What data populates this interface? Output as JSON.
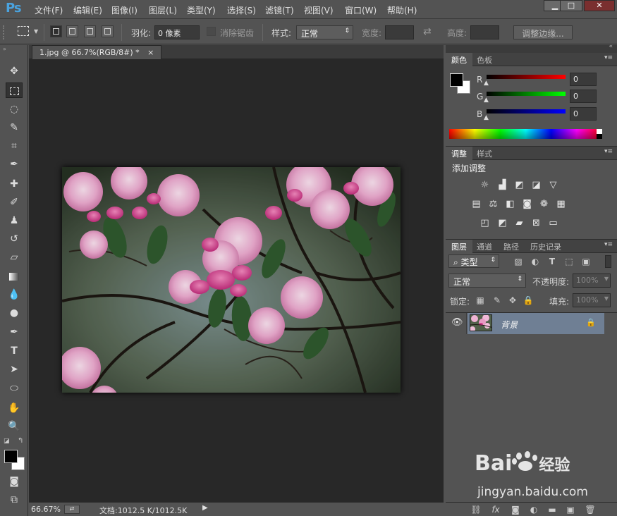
{
  "app": {
    "logo": "Ps"
  },
  "menu": [
    "文件(F)",
    "编辑(E)",
    "图像(I)",
    "图层(L)",
    "类型(Y)",
    "选择(S)",
    "滤镜(T)",
    "视图(V)",
    "窗口(W)",
    "帮助(H)"
  ],
  "options": {
    "feather_label": "羽化:",
    "feather_value": "0 像素",
    "antialias_label": "消除锯齿",
    "style_label": "样式:",
    "style_value": "正常",
    "width_label": "宽度:",
    "height_label": "高度:",
    "refine_button": "调整边缘..."
  },
  "document": {
    "tab_title": "1.jpg @ 66.7%(RGB/8#) *",
    "tab_close": "×"
  },
  "status": {
    "zoom": "66.67%",
    "doc_info": "文档:1012.5 K/1012.5K"
  },
  "color_panel": {
    "tabs": [
      "颜色",
      "色板"
    ],
    "channels": [
      {
        "label": "R",
        "value": "0",
        "color": "#e01010"
      },
      {
        "label": "G",
        "value": "0",
        "color": "#10c020"
      },
      {
        "label": "B",
        "value": "0",
        "color": "#1030e0"
      }
    ]
  },
  "adjust_panel": {
    "tabs": [
      "调整",
      "样式"
    ],
    "title": "添加调整"
  },
  "layers_panel": {
    "tabs": [
      "图层",
      "通道",
      "路径",
      "历史记录"
    ],
    "filter_kind": "类型",
    "blend_mode": "正常",
    "opacity_label": "不透明度:",
    "opacity_value": "100%",
    "lock_label": "锁定:",
    "fill_label": "填充:",
    "fill_value": "100%",
    "layers": [
      {
        "name": "背景",
        "locked": true,
        "visible": true
      }
    ]
  },
  "watermark": {
    "brand_left": "Bai",
    "brand_right": "经验",
    "url": "jingyan.baidu.com"
  },
  "colors": {
    "accent": "#4aa3df",
    "ui_bg": "#535353",
    "doc_bg": "#282828",
    "layer_selected": "#6f7f94"
  }
}
